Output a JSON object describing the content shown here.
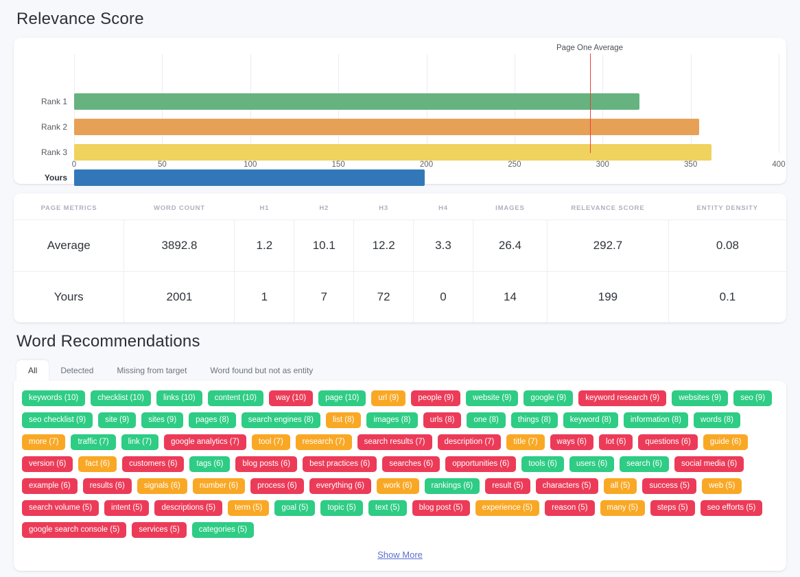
{
  "relevance": {
    "title": "Relevance Score",
    "chart_data": {
      "type": "bar",
      "orientation": "horizontal",
      "title": "Relevance Score",
      "xlabel": "",
      "ylabel": "",
      "categories": [
        "Rank 1",
        "Rank 2",
        "Rank 3",
        "Yours"
      ],
      "values": [
        321,
        355,
        362,
        199
      ],
      "colors": [
        "#66b37f",
        "#e6a156",
        "#f0d25e",
        "#3278b8"
      ],
      "xlim": [
        0,
        400
      ],
      "xticks": [
        0,
        50,
        100,
        150,
        200,
        250,
        300,
        350,
        400
      ],
      "xtick_labels": [
        "0",
        "50",
        "100",
        "150",
        "200",
        "250",
        "300",
        "350",
        "400"
      ],
      "grid": true,
      "legend": "none",
      "annotations": [
        {
          "label": "Page One Average",
          "value": 292.7,
          "color": "#ef3b3b",
          "type": "vertical-reference-line"
        }
      ]
    }
  },
  "metrics": {
    "headers": [
      "PAGE METRICS",
      "WORD COUNT",
      "H1",
      "H2",
      "H3",
      "H4",
      "IMAGES",
      "RELEVANCE SCORE",
      "ENTITY DENSITY"
    ],
    "rows": [
      [
        "Average",
        "3892.8",
        "1.2",
        "10.1",
        "12.2",
        "3.3",
        "26.4",
        "292.7",
        "0.08"
      ],
      [
        "Yours",
        "2001",
        "1",
        "7",
        "72",
        "0",
        "14",
        "199",
        "0.1"
      ]
    ]
  },
  "words": {
    "title": "Word Recommendations",
    "tabs": [
      {
        "label": "All",
        "active": true
      },
      {
        "label": "Detected",
        "active": false
      },
      {
        "label": "Missing from target",
        "active": false
      },
      {
        "label": "Word found but not as entity",
        "active": false
      }
    ],
    "show_more_label": "Show More",
    "tags": [
      {
        "label": "keywords (10)",
        "color": "green"
      },
      {
        "label": "checklist (10)",
        "color": "green"
      },
      {
        "label": "links (10)",
        "color": "green"
      },
      {
        "label": "content (10)",
        "color": "green"
      },
      {
        "label": "way (10)",
        "color": "red"
      },
      {
        "label": "page (10)",
        "color": "green"
      },
      {
        "label": "url (9)",
        "color": "orange"
      },
      {
        "label": "people (9)",
        "color": "red"
      },
      {
        "label": "website (9)",
        "color": "green"
      },
      {
        "label": "google (9)",
        "color": "green"
      },
      {
        "label": "keyword research (9)",
        "color": "red"
      },
      {
        "label": "websites (9)",
        "color": "green"
      },
      {
        "label": "seo (9)",
        "color": "green"
      },
      {
        "label": "seo checklist (9)",
        "color": "green"
      },
      {
        "label": "site (9)",
        "color": "green"
      },
      {
        "label": "sites (9)",
        "color": "green"
      },
      {
        "label": "pages (8)",
        "color": "green"
      },
      {
        "label": "search engines (8)",
        "color": "green"
      },
      {
        "label": "list (8)",
        "color": "orange"
      },
      {
        "label": "images (8)",
        "color": "green"
      },
      {
        "label": "urls (8)",
        "color": "red"
      },
      {
        "label": "one (8)",
        "color": "green"
      },
      {
        "label": "things (8)",
        "color": "green"
      },
      {
        "label": "keyword (8)",
        "color": "green"
      },
      {
        "label": "information (8)",
        "color": "green"
      },
      {
        "label": "words (8)",
        "color": "green"
      },
      {
        "label": "more (7)",
        "color": "orange"
      },
      {
        "label": "traffic (7)",
        "color": "green"
      },
      {
        "label": "link (7)",
        "color": "green"
      },
      {
        "label": "google analytics (7)",
        "color": "red"
      },
      {
        "label": "tool (7)",
        "color": "orange"
      },
      {
        "label": "research (7)",
        "color": "orange"
      },
      {
        "label": "search results (7)",
        "color": "red"
      },
      {
        "label": "description (7)",
        "color": "red"
      },
      {
        "label": "title (7)",
        "color": "orange"
      },
      {
        "label": "ways (6)",
        "color": "red"
      },
      {
        "label": "lot (6)",
        "color": "red"
      },
      {
        "label": "questions (6)",
        "color": "red"
      },
      {
        "label": "guide (6)",
        "color": "orange"
      },
      {
        "label": "version (6)",
        "color": "red"
      },
      {
        "label": "fact (6)",
        "color": "orange"
      },
      {
        "label": "customers (6)",
        "color": "red"
      },
      {
        "label": "tags (6)",
        "color": "green"
      },
      {
        "label": "blog posts (6)",
        "color": "red"
      },
      {
        "label": "best practices (6)",
        "color": "red"
      },
      {
        "label": "searches (6)",
        "color": "red"
      },
      {
        "label": "opportunities (6)",
        "color": "red"
      },
      {
        "label": "tools (6)",
        "color": "green"
      },
      {
        "label": "users (6)",
        "color": "green"
      },
      {
        "label": "search (6)",
        "color": "green"
      },
      {
        "label": "social media (6)",
        "color": "red"
      },
      {
        "label": "example (6)",
        "color": "red"
      },
      {
        "label": "results (6)",
        "color": "red"
      },
      {
        "label": "signals (6)",
        "color": "orange"
      },
      {
        "label": "number (6)",
        "color": "orange"
      },
      {
        "label": "process (6)",
        "color": "red"
      },
      {
        "label": "everything (6)",
        "color": "red"
      },
      {
        "label": "work (6)",
        "color": "orange"
      },
      {
        "label": "rankings (6)",
        "color": "green"
      },
      {
        "label": "result (5)",
        "color": "red"
      },
      {
        "label": "characters (5)",
        "color": "red"
      },
      {
        "label": "all (5)",
        "color": "orange"
      },
      {
        "label": "success (5)",
        "color": "red"
      },
      {
        "label": "web (5)",
        "color": "orange"
      },
      {
        "label": "search volume (5)",
        "color": "red"
      },
      {
        "label": "intent (5)",
        "color": "red"
      },
      {
        "label": "descriptions (5)",
        "color": "red"
      },
      {
        "label": "term (5)",
        "color": "orange"
      },
      {
        "label": "goal (5)",
        "color": "green"
      },
      {
        "label": "topic (5)",
        "color": "green"
      },
      {
        "label": "text (5)",
        "color": "green"
      },
      {
        "label": "blog post (5)",
        "color": "red"
      },
      {
        "label": "experience (5)",
        "color": "orange"
      },
      {
        "label": "reason (5)",
        "color": "red"
      },
      {
        "label": "many (5)",
        "color": "orange"
      },
      {
        "label": "steps (5)",
        "color": "red"
      },
      {
        "label": "seo efforts (5)",
        "color": "red"
      },
      {
        "label": "google search console (5)",
        "color": "red"
      },
      {
        "label": "services (5)",
        "color": "red"
      },
      {
        "label": "categories (5)",
        "color": "green"
      }
    ]
  }
}
